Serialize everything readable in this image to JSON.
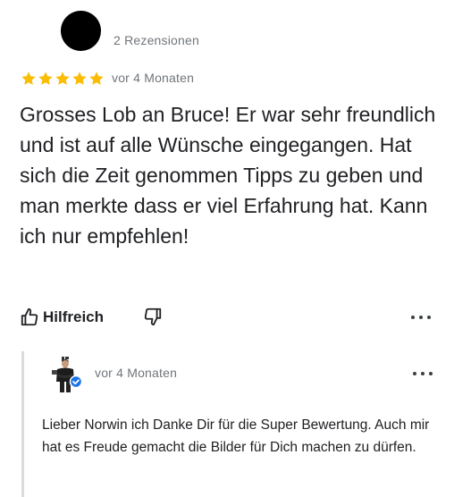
{
  "review": {
    "author_review_count": "2 Rezensionen",
    "rating_stars": 5,
    "rating_max": 5,
    "time": "vor 4 Monaten",
    "text": "Grosses Lob an Bruce! Er war sehr freundlich und ist auf alle Wünsche eingegangen. Hat sich die Zeit genommen Tipps zu geben und man merkte dass er viel Erfahrung hat. Kann ich nur empfehlen!",
    "actions": {
      "helpful_label": "Hilfreich",
      "helpful_icon": "thumbs-up-icon",
      "unhelpful_icon": "thumbs-down-icon",
      "more_icon": "more-horizontal-icon"
    }
  },
  "owner_reply": {
    "time": "vor 4 Monaten",
    "text": "Lieber Norwin ich Danke Dir für die Super Bewertung. Auch mir hat es Freude gemacht die Bilder für Dich machen zu dürfen.",
    "verified_icon": "verified-check-icon",
    "more_icon": "more-horizontal-icon"
  },
  "colors": {
    "star": "#fbbc04",
    "text": "#202124",
    "secondary_text": "#70757a",
    "divider": "#dadce0",
    "verified": "#1a73e8"
  }
}
